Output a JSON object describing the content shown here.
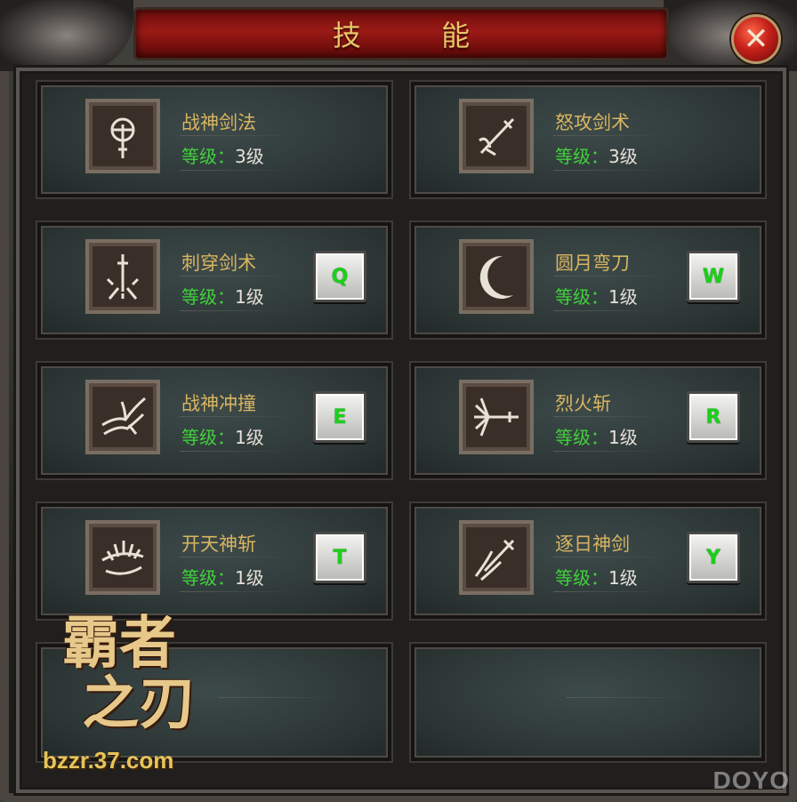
{
  "window": {
    "title": "技 能",
    "close_label": "✕"
  },
  "level_label": "等级：",
  "skills": [
    {
      "name": "战神剑法",
      "level": "3级",
      "key": "",
      "icon": "trident-sword-icon"
    },
    {
      "name": "怒攻剑术",
      "level": "3级",
      "key": "",
      "icon": "crossed-swords-icon"
    },
    {
      "name": "刺穿剑术",
      "level": "1级",
      "key": "Q",
      "icon": "piercing-sword-icon"
    },
    {
      "name": "圆月弯刀",
      "level": "1级",
      "key": "W",
      "icon": "crescent-moon-icon"
    },
    {
      "name": "战神冲撞",
      "level": "1级",
      "key": "E",
      "icon": "charge-burst-icon"
    },
    {
      "name": "烈火斩",
      "level": "1级",
      "key": "R",
      "icon": "flame-slash-icon"
    },
    {
      "name": "开天神斩",
      "level": "1级",
      "key": "T",
      "icon": "sky-splitter-icon"
    },
    {
      "name": "逐日神剑",
      "level": "1级",
      "key": "Y",
      "icon": "sun-chaser-sword-icon"
    }
  ],
  "branding": {
    "logo_text": "霸者之刃",
    "url": "bzzr.37.com",
    "watermark": "DOYO"
  },
  "colors": {
    "name": "#d9b560",
    "level_label": "#41d13c",
    "key_letter": "#1bd01b",
    "title": "#e8c56a"
  }
}
